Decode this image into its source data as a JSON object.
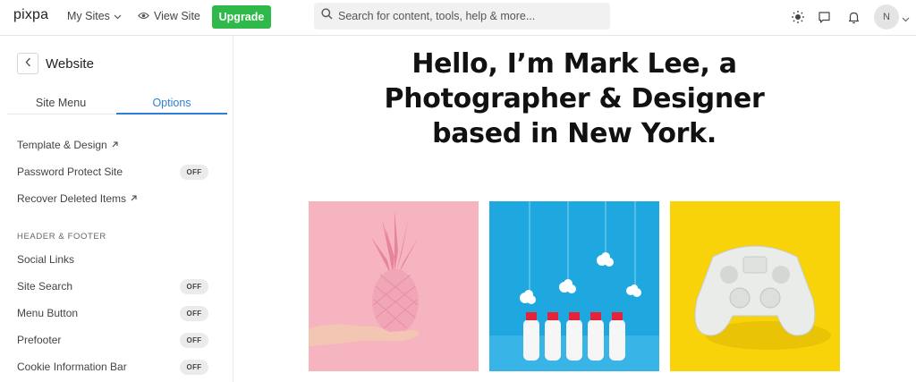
{
  "topbar": {
    "logo": "pixpa",
    "my_sites": "My Sites",
    "view_site": "View Site",
    "upgrade": "Upgrade",
    "search_placeholder": "Search for content, tools, help & more...",
    "avatar_initial": "N"
  },
  "sidebar": {
    "title": "Website",
    "tabs": {
      "site_menu": "Site Menu",
      "options": "Options"
    },
    "items": [
      {
        "label": "Template & Design",
        "external": true
      },
      {
        "label": "Password Protect Site",
        "toggle": "OFF"
      },
      {
        "label": "Recover Deleted Items",
        "external": true
      }
    ],
    "section_header": "HEADER & FOOTER",
    "section_items": [
      {
        "label": "Social Links"
      },
      {
        "label": "Site Search",
        "toggle": "OFF"
      },
      {
        "label": "Menu Button",
        "toggle": "OFF"
      },
      {
        "label": "Prefooter",
        "toggle": "OFF"
      },
      {
        "label": "Cookie Information Bar",
        "toggle": "OFF"
      }
    ]
  },
  "main": {
    "headline": "Hello, I’m Mark Lee, a Photographer & Designer based in New York."
  },
  "colors": {
    "accent": "#2f7fd8",
    "upgrade": "#2fb94a",
    "tile_pink": "#f5b4c0",
    "tile_blue": "#1ea8df",
    "tile_yellow": "#f8d30a"
  },
  "icons": [
    "chevron-down-icon",
    "eye-icon",
    "search-icon",
    "sun-icon",
    "chat-icon",
    "bell-icon",
    "chevron-left-icon",
    "external-arrow-icon"
  ]
}
